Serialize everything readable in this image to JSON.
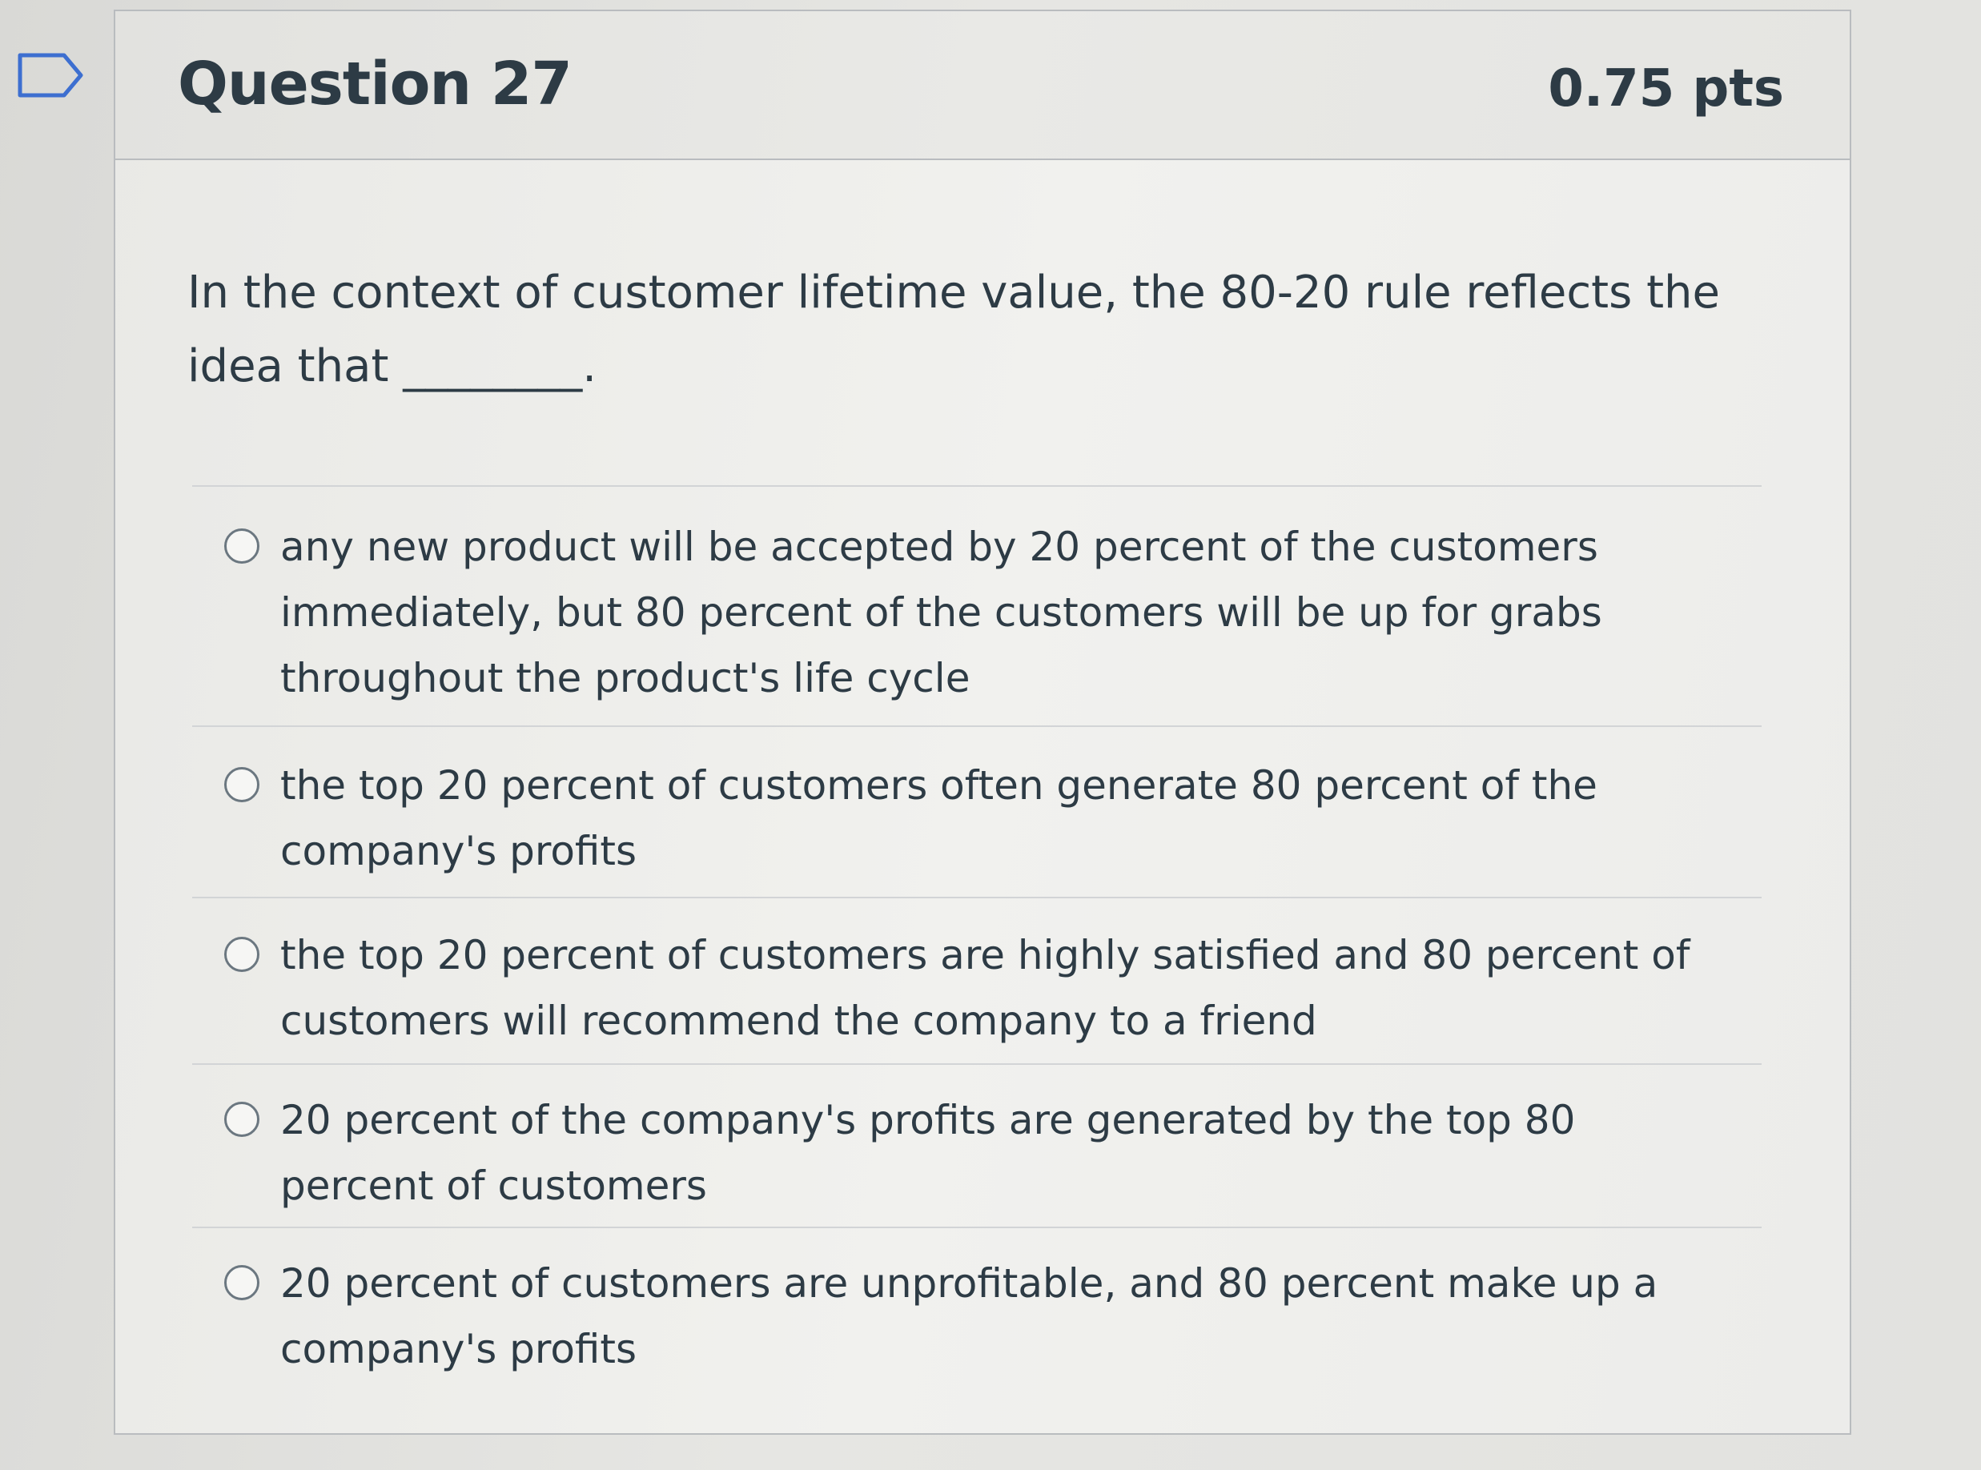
{
  "question": {
    "title": "Question 27",
    "points": "0.75 pts",
    "text": "In the context of customer lifetime value, the 80-20 rule reflects the idea that ________."
  },
  "answers": [
    {
      "label": "any new product will be accepted by 20 percent of the customers immediately, but 80 percent of the customers will be up for grabs throughout the product's life cycle"
    },
    {
      "label": "the top 20 percent of customers often generate 80 percent of the company's profits"
    },
    {
      "label": "the top 20 percent of customers are highly satisfied and 80 percent of customers will recommend the company to a friend"
    },
    {
      "label": "20 percent of the company's profits are generated by the top 80 percent of customers"
    },
    {
      "label": "20 percent of customers are unprofitable, and 80 percent make up a company's profits"
    }
  ]
}
